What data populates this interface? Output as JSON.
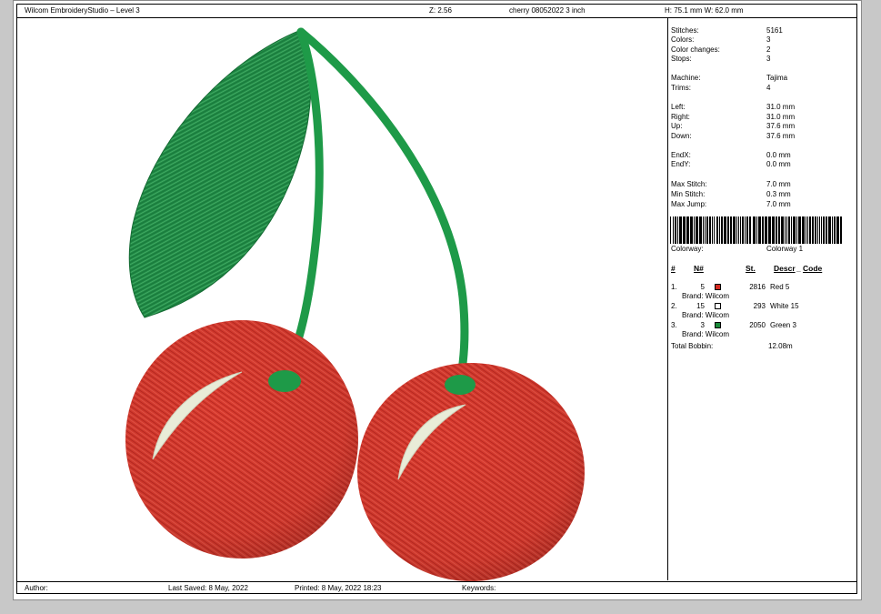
{
  "header": {
    "app_title": "Wilcom EmbroideryStudio – Level 3",
    "zoom": "Z: 2.56",
    "filename": "cherry 08052022 3 inch",
    "dimensions": "H: 75.1 mm   W: 62.0 mm"
  },
  "stats": [
    {
      "label": "Stitches:",
      "value": "5161"
    },
    {
      "label": "Colors:",
      "value": "3"
    },
    {
      "label": "Color changes:",
      "value": "2"
    },
    {
      "label": "Stops:",
      "value": "3"
    },
    {
      "label": "Machine:",
      "value": "Tajima"
    },
    {
      "label": "Trims:",
      "value": "4"
    },
    {
      "label": "Left:",
      "value": "31.0 mm"
    },
    {
      "label": "Right:",
      "value": "31.0 mm"
    },
    {
      "label": "Up:",
      "value": "37.6 mm"
    },
    {
      "label": "Down:",
      "value": "37.6 mm"
    },
    {
      "label": "EndX:",
      "value": "0.0 mm"
    },
    {
      "label": "EndY:",
      "value": "0.0 mm"
    },
    {
      "label": "Max Stitch:",
      "value": "7.0 mm"
    },
    {
      "label": "Min Stitch:",
      "value": "0.3 mm"
    },
    {
      "label": "Max Jump:",
      "value": "7.0 mm"
    }
  ],
  "colorway": {
    "label": "Colorway:",
    "value": "Colorway 1"
  },
  "color_table": {
    "headers": {
      "index": "#",
      "number": "N#",
      "stitches": "St.",
      "descr": "Descr",
      "code": "Code"
    },
    "rows": [
      {
        "index": "1.",
        "number": "5",
        "swatch_color": "#d42a20",
        "stitches": "2816",
        "descr": "Red 5",
        "brand": "Brand: Wilcom"
      },
      {
        "index": "2.",
        "number": "15",
        "swatch_color": "#ffffff",
        "stitches": "293",
        "descr": "White 15",
        "brand": "Brand: Wilcom"
      },
      {
        "index": "3.",
        "number": "3",
        "swatch_color": "#1a8a3a",
        "stitches": "2050",
        "descr": "Green 3",
        "brand": "Brand: Wilcom"
      }
    ],
    "total_bobbin_label": "Total Bobbin:",
    "total_bobbin_value": "12.08m"
  },
  "footer": {
    "author_label": "Author:",
    "last_saved": "Last Saved:  8 May, 2022",
    "printed": "Printed:  8 May, 2022 18:23",
    "keywords_label": "Keywords:"
  },
  "design_colors": {
    "cherry": "#d83a2e",
    "cherry_dark": "#b82820",
    "leaf": "#1f8a45",
    "stem": "#1e9a48",
    "highlight": "#e9ecd8"
  }
}
